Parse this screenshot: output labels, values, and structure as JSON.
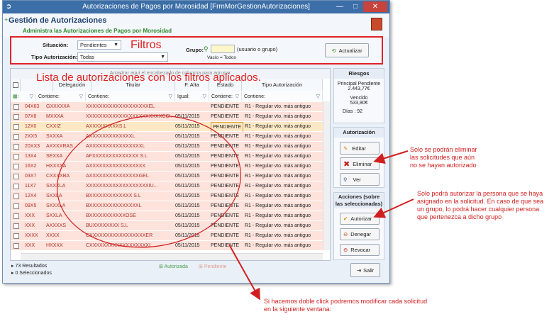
{
  "window": {
    "title": "Autorizaciones de Pagos por Morosidad [FrmMorGestionAutorizaciones]",
    "min": "—",
    "max": "□",
    "close": "✕"
  },
  "header": {
    "title": "Gestión de Autorizaciones",
    "subtitle": "Administra las Autorizaciones de Pagos por Morosidad",
    "expand": "+"
  },
  "filters": {
    "situacion_label": "Situación:",
    "situacion_value": "Pendientes",
    "tipo_label": "Tipo Autorización:",
    "tipo_value": "Todas",
    "grupo_label": "Grupo:",
    "grupo_hint": "(usuario o grupo)",
    "grupo_empty": "Vacío = Todos",
    "update_label": "Actualizar",
    "annotation": "Filtros"
  },
  "grid": {
    "annotation": "Lista de autorizaciones con los filtros aplicados.",
    "group_hint": "Arrastrar aquí el encabezado de columna para agrupar",
    "columns": [
      "",
      "Delegación",
      "Titular",
      "F. Alta",
      "Estado",
      "Tipo Autorización"
    ],
    "filters": [
      ":",
      "Contiene:",
      "Contiene:",
      "Igual:",
      "Contiene:",
      "Contiene:"
    ],
    "rows": [
      {
        "id": "04X63",
        "deleg": "GXXXXXA",
        "titular": "XXXXXXXXXXXXXXXXXXXEL",
        "fecha": "",
        "estado": "PENDIENTE",
        "tipo": "R1 - Regular vto. más antiguo"
      },
      {
        "id": "07X8",
        "deleg": "MXXXA",
        "titular": "XXXXXXXXXXXXXXXXXXXXXXXCCI...",
        "fecha": "05/11/2015",
        "estado": "PENDIENTE",
        "tipo": "R1 - Regular vto. más antiguo"
      },
      {
        "id": "12X0",
        "deleg": "CXXIZ",
        "titular": "AXXXXXXXXXS.L",
        "fecha": "05/11/2015",
        "estado": "PENDIENTE",
        "tipo": "R1 - Regular vto. más antiguo"
      },
      {
        "id": "2XX5",
        "deleg": "SXXXA",
        "titular": "AXXXXXXXXXXXXXL",
        "fecha": "05/11/2015",
        "estado": "PENDIENTE",
        "tipo": "R1 - Regular vto. más antiguo"
      },
      {
        "id": "20XX3",
        "deleg": "AXXXXRAS",
        "titular": "AXXXXXXXXXXXXXXXXL",
        "fecha": "05/11/2015",
        "estado": "PENDIENTE",
        "tipo": "R1 - Regular vto. más antiguo"
      },
      {
        "id": "13X4",
        "deleg": "SEXXA",
        "titular": "AFXXXXXXXXXXXXXX S.L",
        "fecha": "05/11/2015",
        "estado": "PENDIENTE",
        "tipo": "R1 - Regular vto. más antiguo"
      },
      {
        "id": "16X2",
        "deleg": "HXXXXA",
        "titular": "AXXXXXXXXXXXXXXXXX",
        "fecha": "05/11/2015",
        "estado": "PENDIENTE",
        "tipo": "R1 - Regular vto. más antiguo"
      },
      {
        "id": "03X7",
        "deleg": "CXXXXBA",
        "titular": "AXXXXXXXXXXXXXXXGEL",
        "fecha": "05/11/2015",
        "estado": "PENDIENTE",
        "tipo": "R1 - Regular vto. más antiguo"
      },
      {
        "id": "11X7",
        "deleg": "SXXXLA",
        "titular": "XXXXXXXXXXXXXXXXXXXIU...",
        "fecha": "05/11/2015",
        "estado": "PENDIENTE",
        "tipo": "R1 - Regular vto. más antiguo"
      },
      {
        "id": "12X4",
        "deleg": "SXXLA",
        "titular": "BXXXXXXXXXXXXX S.L",
        "fecha": "05/11/2015",
        "estado": "PENDIENTE",
        "tipo": "R1 - Regular vto. más antiguo"
      },
      {
        "id": "09X5",
        "deleg": "SXXXLA",
        "titular": "BXXXXXXXXXXXXXXXL",
        "fecha": "05/11/2015",
        "estado": "PENDIENTE",
        "tipo": "R1 - Regular vto. más antiguo"
      },
      {
        "id": "XXX",
        "deleg": "SXXLA",
        "titular": "BXXXXXXXXXXXOSE",
        "fecha": "05/11/2015",
        "estado": "PENDIENTE",
        "tipo": "R1 - Regular vto. más antiguo"
      },
      {
        "id": "XXX",
        "deleg": "AXXXXS",
        "titular": "BUXXXXXXXX S.L",
        "fecha": "05/11/2015",
        "estado": "PENDIENTE",
        "tipo": "R1 - Regular vto. más antiguo"
      },
      {
        "id": "XXXX",
        "deleg": "XXXX",
        "titular": "CXXXXXXXXXXXXXXXXXER",
        "fecha": "05/11/2015",
        "estado": "PENDIENTE",
        "tipo": "R1 - Regular vto. más antiguo"
      },
      {
        "id": "XXX",
        "deleg": "HXXXX",
        "titular": "CXXXXXXXXXXXXXXXXXXL",
        "fecha": "05/11/2015",
        "estado": "PENDIENTE",
        "tipo": "R1 - Regular vto. más antiguo"
      }
    ],
    "legend_autorizada": "Autorizada",
    "legend_pendiente": "Pendiente",
    "count_results": "73 Resultados",
    "count_selected": "0 Seleccionados"
  },
  "riesgos": {
    "title": "Riesgos",
    "principal_label": "Principal Pendiente",
    "principal_value": "2.443,77€",
    "vencido_label": "Vencido",
    "vencido_value": "533,80€",
    "dias_label": "Días :",
    "dias_value": "92"
  },
  "autorizacion": {
    "title": "Autorización",
    "editar": "Editar",
    "eliminar": "Eliminar",
    "ver": "Ver"
  },
  "acciones": {
    "title": "Acciones (sobre las seleccionadas)",
    "autorizar": "Autorizar",
    "denegar": "Denegar",
    "revocar": "Revocar"
  },
  "salir": "Salir",
  "annotations": {
    "eliminar_note": "Solo se podrán eliminar las solicitudes que aún no se hayan autorizado",
    "autorizar_note": "Solo podrá autorizar la persona que se haya asignado en la solicitud. En caso de que sea un grupo, lo podrá hacer cualquier persona que pertenezca a dicho grupo",
    "doble_click_note": "Si hacemos doble click podremos modificar cada solicitud en la siguiente ventana:"
  },
  "colors": {
    "titlebar": "#3c6ea7",
    "annotation": "#e02020",
    "pending_row": "#fde3dc",
    "selected_row": "#fde9c5"
  }
}
